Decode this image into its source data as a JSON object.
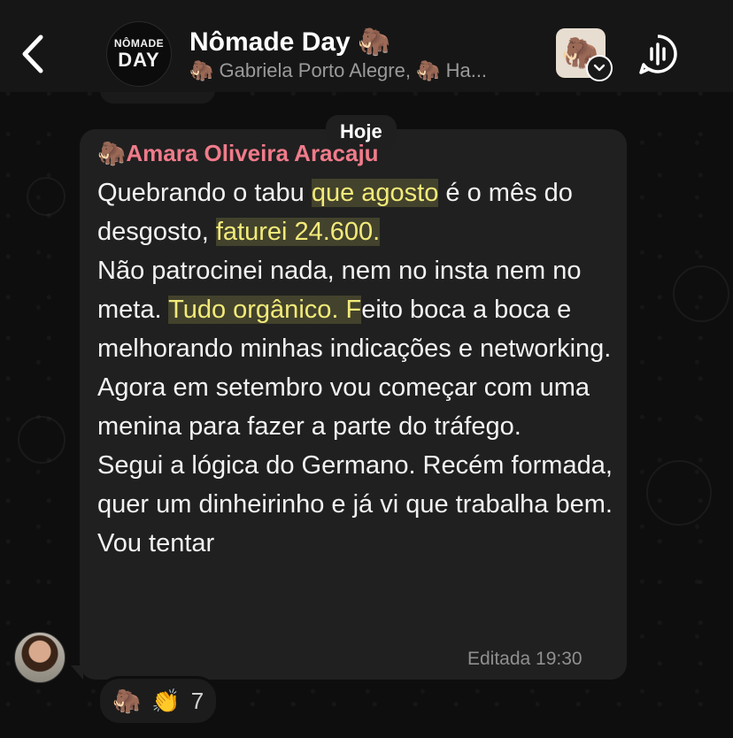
{
  "header": {
    "back_label": "Back",
    "group_avatar_line1": "NÔMADE",
    "group_avatar_line2": "DAY",
    "title": "Nômade Day 🦣",
    "subtitle": "🦣 Gabriela Porto Alegre, 🦣 Ha...",
    "community_icon": "mammoth-icon",
    "call_icon": "voice-call-icon"
  },
  "chat": {
    "date_label": "Hoje",
    "message": {
      "sender": "🦣Amara Oliveira Aracaju",
      "seg1": "Quebrando o tabu ",
      "hl1": "que agosto",
      "seg2": " é o mês do desgosto, ",
      "hl2": "faturei 24.600.",
      "seg3": "Não patrocinei nada, nem no insta nem no meta. ",
      "hl3": "Tudo orgânico. F",
      "seg4": "eito boca a boca e melhorando minhas indicações e networking.",
      "para3": "Agora em setembro vou começar com uma menina para fazer a parte do tráfego.",
      "para4": "Segui a lógica do Germano. Recém formada, quer um dinheirinho e já vi que trabalha bem. Vou tentar",
      "meta": "Editada 19:30",
      "reactions": {
        "emoji1": "🦣",
        "emoji2": "👏",
        "count": "7"
      }
    }
  }
}
